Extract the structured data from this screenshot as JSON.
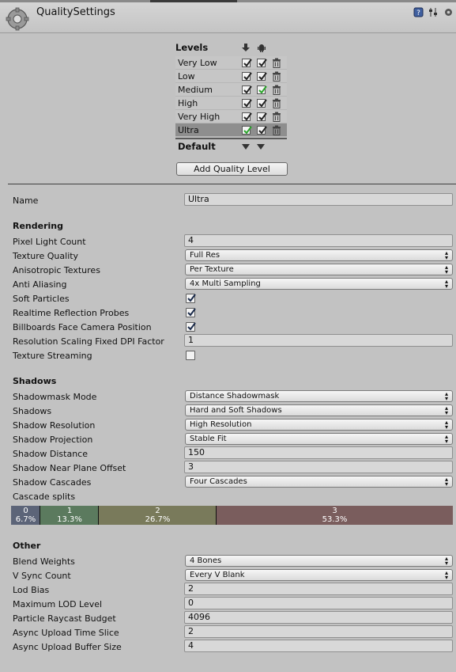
{
  "window": {
    "title": "QualitySettings"
  },
  "levels": {
    "heading": "Levels",
    "rows": [
      {
        "name": "Very Low",
        "pc": true,
        "android": true,
        "selected": false,
        "default_pc": false,
        "default_android": false
      },
      {
        "name": "Low",
        "pc": true,
        "android": true,
        "selected": false,
        "default_pc": false,
        "default_android": false
      },
      {
        "name": "Medium",
        "pc": true,
        "android": true,
        "selected": false,
        "default_pc": false,
        "default_android": true
      },
      {
        "name": "High",
        "pc": true,
        "android": true,
        "selected": false,
        "default_pc": false,
        "default_android": false
      },
      {
        "name": "Very High",
        "pc": true,
        "android": true,
        "selected": false,
        "default_pc": false,
        "default_android": false
      },
      {
        "name": "Ultra",
        "pc": true,
        "android": true,
        "selected": true,
        "default_pc": true,
        "default_android": false
      }
    ],
    "default_label": "Default",
    "add_button": "Add Quality Level"
  },
  "name": {
    "label": "Name",
    "value": "Ultra"
  },
  "rendering": {
    "heading": "Rendering",
    "pixel_light_count": {
      "label": "Pixel Light Count",
      "value": "4"
    },
    "texture_quality": {
      "label": "Texture Quality",
      "value": "Full Res"
    },
    "anisotropic_textures": {
      "label": "Anisotropic Textures",
      "value": "Per Texture"
    },
    "anti_aliasing": {
      "label": "Anti Aliasing",
      "value": "4x Multi Sampling"
    },
    "soft_particles": {
      "label": "Soft Particles",
      "checked": true
    },
    "realtime_reflection_probes": {
      "label": "Realtime Reflection Probes",
      "checked": true
    },
    "billboards_face_camera": {
      "label": "Billboards Face Camera Position",
      "checked": true
    },
    "resolution_scaling": {
      "label": "Resolution Scaling Fixed DPI Factor",
      "value": "1"
    },
    "texture_streaming": {
      "label": "Texture Streaming",
      "checked": false
    }
  },
  "shadows": {
    "heading": "Shadows",
    "shadowmask_mode": {
      "label": "Shadowmask Mode",
      "value": "Distance Shadowmask"
    },
    "shadows": {
      "label": "Shadows",
      "value": "Hard and Soft Shadows"
    },
    "shadow_resolution": {
      "label": "Shadow Resolution",
      "value": "High Resolution"
    },
    "shadow_projection": {
      "label": "Shadow Projection",
      "value": "Stable Fit"
    },
    "shadow_distance": {
      "label": "Shadow Distance",
      "value": "150"
    },
    "shadow_near_plane_offset": {
      "label": "Shadow Near Plane Offset",
      "value": "3"
    },
    "shadow_cascades": {
      "label": "Shadow Cascades",
      "value": "Four Cascades"
    },
    "cascade_splits_label": "Cascade splits",
    "cascades": [
      {
        "index": "0",
        "percent": "6.7%",
        "fraction": 0.067,
        "color": "#5c6478"
      },
      {
        "index": "1",
        "percent": "13.3%",
        "fraction": 0.133,
        "color": "#5b7a5e"
      },
      {
        "index": "2",
        "percent": "26.7%",
        "fraction": 0.267,
        "color": "#797a5b"
      },
      {
        "index": "3",
        "percent": "53.3%",
        "fraction": 0.533,
        "color": "#7a5d5d"
      }
    ]
  },
  "other": {
    "heading": "Other",
    "blend_weights": {
      "label": "Blend Weights",
      "value": "4 Bones"
    },
    "vsync_count": {
      "label": "V Sync Count",
      "value": "Every V Blank"
    },
    "lod_bias": {
      "label": "Lod Bias",
      "value": "2"
    },
    "maximum_lod_level": {
      "label": "Maximum LOD Level",
      "value": "0"
    },
    "particle_raycast_budget": {
      "label": "Particle Raycast Budget",
      "value": "4096"
    },
    "async_upload_time_slice": {
      "label": "Async Upload Time Slice",
      "value": "2"
    },
    "async_upload_buffer_size": {
      "label": "Async Upload Buffer Size",
      "value": "4"
    }
  },
  "colors": {
    "accent_check": "#2aa52a",
    "selected_row": "#8e8e8e",
    "panel_bg": "#c2c2c2"
  }
}
